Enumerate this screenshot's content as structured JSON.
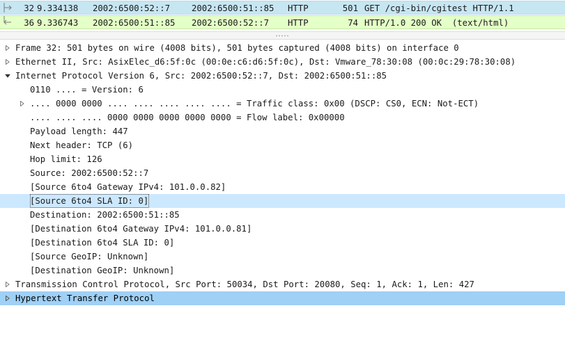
{
  "packets": [
    {
      "no": "32",
      "time": "9.334138",
      "src": "2002:6500:52::7",
      "dst": "2002:6500:51::85",
      "proto": "HTTP",
      "len": "501",
      "info": "GET /cgi-bin/cgitest HTTP/1.1",
      "direction": "request",
      "color": "#c6e6f2"
    },
    {
      "no": "36",
      "time": "9.336743",
      "src": "2002:6500:51::85",
      "dst": "2002:6500:52::7",
      "proto": "HTTP",
      "len": "74",
      "info": "HTTP/1.0 200 OK  (text/html)",
      "direction": "response",
      "color": "#e4ffc7"
    }
  ],
  "details": {
    "frame": "Frame 32: 501 bytes on wire (4008 bits), 501 bytes captured (4008 bits) on interface 0",
    "ethernet": "Ethernet II, Src: AsixElec_d6:5f:0c (00:0e:c6:d6:5f:0c), Dst: Vmware_78:30:08 (00:0c:29:78:30:08)",
    "ipv6": "Internet Protocol Version 6, Src: 2002:6500:52::7, Dst: 2002:6500:51::85",
    "ipv6_fields": [
      "0110 .... = Version: 6",
      ".... 0000 0000 .... .... .... .... .... = Traffic class: 0x00 (DSCP: CS0, ECN: Not-ECT)",
      ".... .... .... 0000 0000 0000 0000 0000 = Flow label: 0x00000",
      "Payload length: 447",
      "Next header: TCP (6)",
      "Hop limit: 126",
      "Source: 2002:6500:52::7",
      "[Source 6to4 Gateway IPv4: 101.0.0.82]",
      "[Source 6to4 SLA ID: 0]",
      "Destination: 2002:6500:51::85",
      "[Destination 6to4 Gateway IPv4: 101.0.0.81]",
      "[Destination 6to4 SLA ID: 0]",
      "[Source GeoIP: Unknown]",
      "[Destination GeoIP: Unknown]"
    ],
    "tcp": "Transmission Control Protocol, Src Port: 50034, Dst Port: 20080, Seq: 1, Ack: 1, Len: 427",
    "http": "Hypertext Transfer Protocol"
  },
  "colors": {
    "request_row": "#c6e6f2",
    "response_row": "#e4ffc7",
    "selected_field": "#cce8ff",
    "highlighted_node": "#9fd0f6"
  }
}
